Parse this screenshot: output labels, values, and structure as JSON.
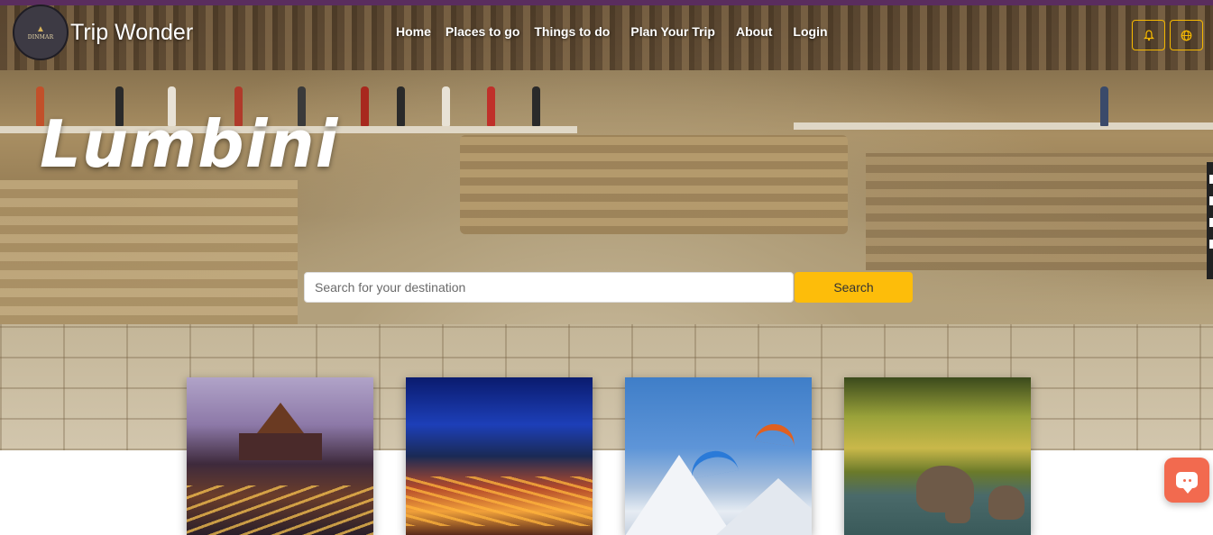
{
  "header": {
    "logo_text": "DINMAR",
    "brand": "Trip Wonder",
    "nav": [
      {
        "label": "Home"
      },
      {
        "label": "Places to go"
      },
      {
        "label": "Things to do"
      },
      {
        "label": "Plan Your Trip"
      },
      {
        "label": "About"
      },
      {
        "label": "Login"
      }
    ],
    "icons": [
      "bell-icon",
      "globe-icon"
    ]
  },
  "hero": {
    "title": "Lumbini",
    "search": {
      "placeholder": "Search for your destination",
      "value": "",
      "button_label": "Search"
    }
  },
  "cards": [
    {
      "image": "temple-photo"
    },
    {
      "image": "city-night-photo"
    },
    {
      "image": "paragliding-photo"
    },
    {
      "image": "elephants-photo"
    }
  ],
  "colors": {
    "accent": "#fdbd0a",
    "chat_button": "#f26a4f",
    "top_bar": "#5a2d5e"
  }
}
